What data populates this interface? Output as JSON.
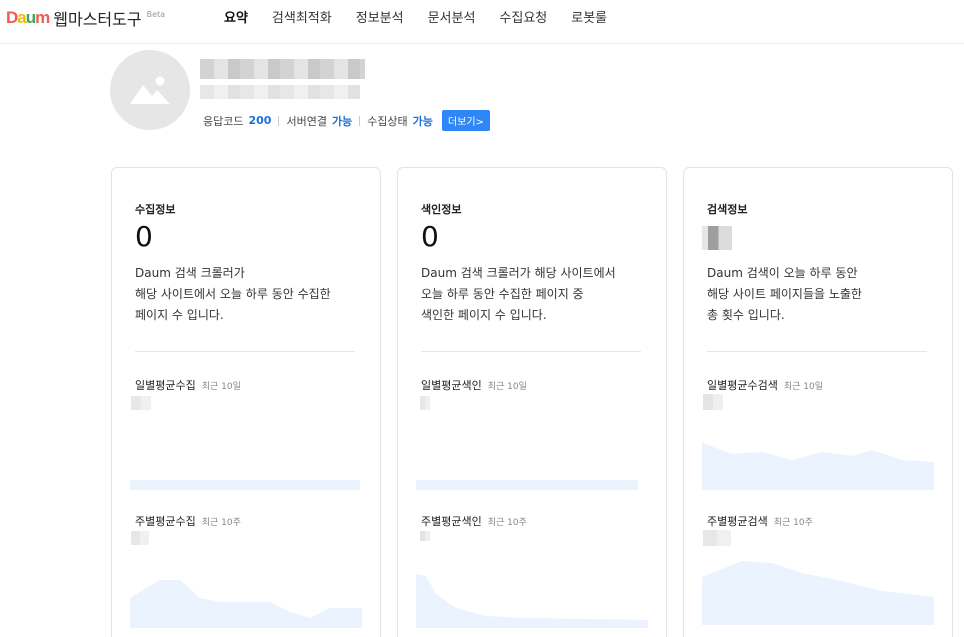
{
  "brand": {
    "logo_letters": [
      "D",
      "a",
      "u",
      "m"
    ],
    "logo_colors": [
      "#f25c54",
      "#f5b800",
      "#3ba55d",
      "#f25c54"
    ],
    "title": "웹마스터도구",
    "beta": "Beta"
  },
  "nav": {
    "items": [
      "요약",
      "검색최적화",
      "정보분석",
      "문서분석",
      "수집요청",
      "로봇룰"
    ],
    "active_index": 0
  },
  "site": {
    "avatar_icon": "image-placeholder-icon",
    "status": {
      "response_label": "응답코드",
      "response_value": "200",
      "server_label": "서버연결",
      "server_value": "가능",
      "crawl_label": "수집상태",
      "crawl_value": "가능",
      "more_label": "더보기>"
    }
  },
  "cards": [
    {
      "title": "수집정보",
      "value": "0",
      "desc": [
        "Daum 검색 크롤러가",
        "해당 사이트에서 오늘 하루 동안 수집한",
        "페이지 수 입니다."
      ],
      "daily_label": "일별평균수집",
      "daily_hint": "최근 10일",
      "weekly_label": "주별평균수집",
      "weekly_hint": "최근 10주"
    },
    {
      "title": "색인정보",
      "value": "0",
      "desc": [
        "Daum 검색 크롤러가 해당 사이트에서",
        "오늘 하루 동안 수집한 페이지 중",
        "색인한 페이지 수 입니다."
      ],
      "daily_label": "일별평균색인",
      "daily_hint": "최근 10일",
      "weekly_label": "주별평균색인",
      "weekly_hint": "최근 10주"
    },
    {
      "title": "검색정보",
      "value": "",
      "desc": [
        "Daum 검색이 오늘 하루 동안",
        "해당 사이트 페이지들을 노출한",
        "총 횟수 입니다."
      ],
      "daily_label": "일별평균수검색",
      "daily_hint": "최근 10일",
      "weekly_label": "주별평균검색",
      "weekly_hint": "최근 10주"
    }
  ],
  "colors": {
    "accent": "#1e6fd9",
    "button": "#2f86f6",
    "chart_fill": "#eaf3fe"
  }
}
